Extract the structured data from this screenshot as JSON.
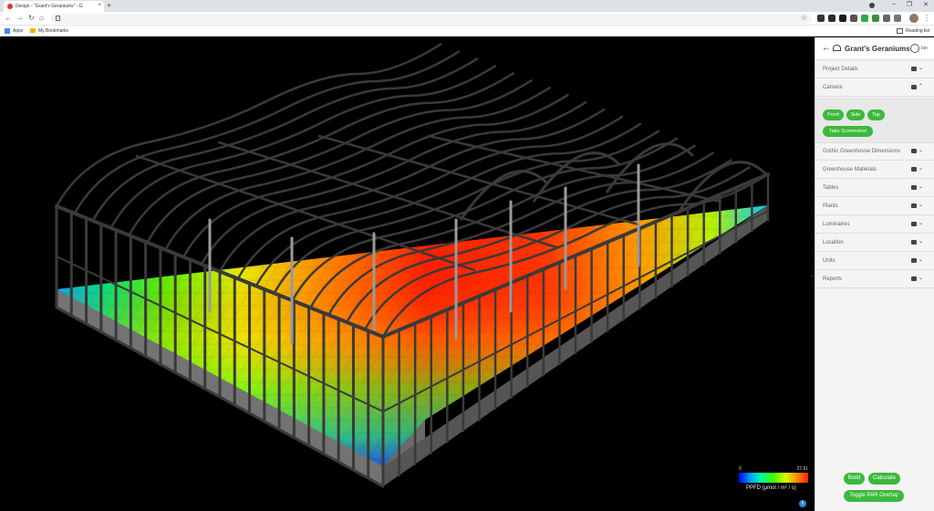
{
  "browser": {
    "tab_title": "Design - \"Grant's Geraniums\" - G",
    "tab_close": "×",
    "new_tab": "+",
    "back": "←",
    "forward": "→",
    "reload": "↻",
    "home": "⌂",
    "star": "☆",
    "kebab": "⋮",
    "win_min": "–",
    "win_max": "❐",
    "win_close": "✕",
    "bookmarks_apps": "Apps",
    "bookmarks_my": "My Bookmarks",
    "reading_list": "Reading list"
  },
  "panel": {
    "title": "Grant's Geraniums",
    "user": "Ian",
    "back_icon": "arrow-left-icon",
    "sections": [
      {
        "label": "Project Details",
        "chevron": "⌄"
      },
      {
        "label": "Camera",
        "chevron": "⌃"
      },
      {
        "label": "Gothic Greenhouse Dimensions",
        "chevron": "⌄"
      },
      {
        "label": "Greenhouse Materials",
        "chevron": "⌄"
      },
      {
        "label": "Tables",
        "chevron": "⌄"
      },
      {
        "label": "Plants",
        "chevron": "⌄"
      },
      {
        "label": "Luminaires",
        "chevron": "⌄"
      },
      {
        "label": "Location",
        "chevron": "⌄"
      },
      {
        "label": "Units",
        "chevron": "⌄"
      },
      {
        "label": "Reports",
        "chevron": "⌄"
      }
    ],
    "camera_buttons": {
      "front": "Front",
      "side": "Side",
      "top": "Top",
      "screenshot": "Take Screenshot"
    },
    "actions": {
      "build": "Build",
      "calculate": "Calculate",
      "toggle_par": "Toggle PAR Overlay"
    },
    "accent_color": "#3cb93c"
  },
  "legend": {
    "min": "0",
    "max": "27.91",
    "label": "PPFD (μmol / m² / s)",
    "info": "i"
  },
  "side_toggle": "▸"
}
